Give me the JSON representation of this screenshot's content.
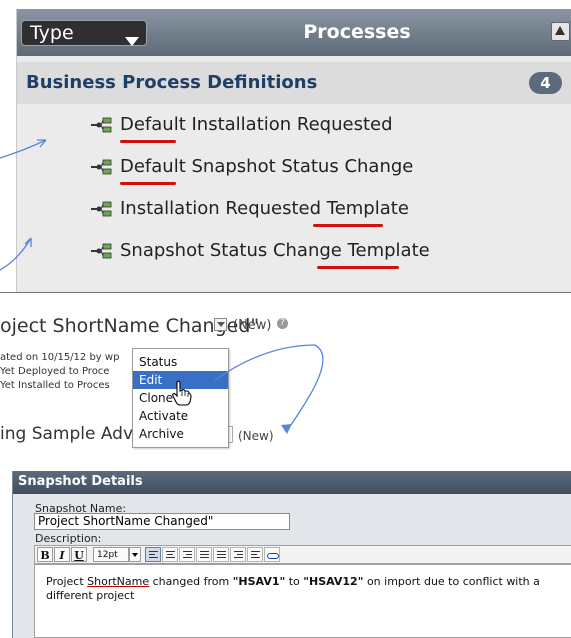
{
  "processes_panel": {
    "type_label": "Type",
    "title": "Processes",
    "section_title": "Business Process Definitions",
    "count": "4",
    "items": [
      {
        "label": "Default Installation Requested"
      },
      {
        "label": "Default Snapshot Status Change"
      },
      {
        "label": "Installation Requested Template"
      },
      {
        "label": "Snapshot Status Change Template"
      }
    ]
  },
  "snapshot": {
    "title": "oject ShortName Changed\"",
    "status": "(New)",
    "meta": [
      "ated on 10/15/12 by wp",
      "Yet Deployed to Proce",
      "Yet Installed to Proces"
    ],
    "second_title": "ing Sample Adva",
    "second_status": "(New)"
  },
  "context_menu": {
    "items": [
      "Status",
      "Edit",
      "Clone",
      "Activate",
      "Archive"
    ],
    "selected": "Edit"
  },
  "snapshot_details": {
    "header": "Snapshot Details",
    "name_label": "Snapshot Name:",
    "name_value": "Project ShortName Changed\"",
    "description_label": "Description:",
    "toolbar": {
      "bold": "B",
      "italic": "I",
      "underline": "U",
      "font_size": "12pt"
    },
    "description": {
      "p1": "Project ",
      "p2": "ShortName",
      "p3": " changed from ",
      "p4": "\"HSAV1\"",
      "p5": " to ",
      "p6": "\"HSAV12\"",
      "p7": " on import due to conflict with a different project"
    }
  },
  "colors": {
    "header_bg": "#6f7b88",
    "selected_menu": "#3a6fc6",
    "annotation_red": "#d01010",
    "annotation_blue": "#4a7bd6"
  }
}
